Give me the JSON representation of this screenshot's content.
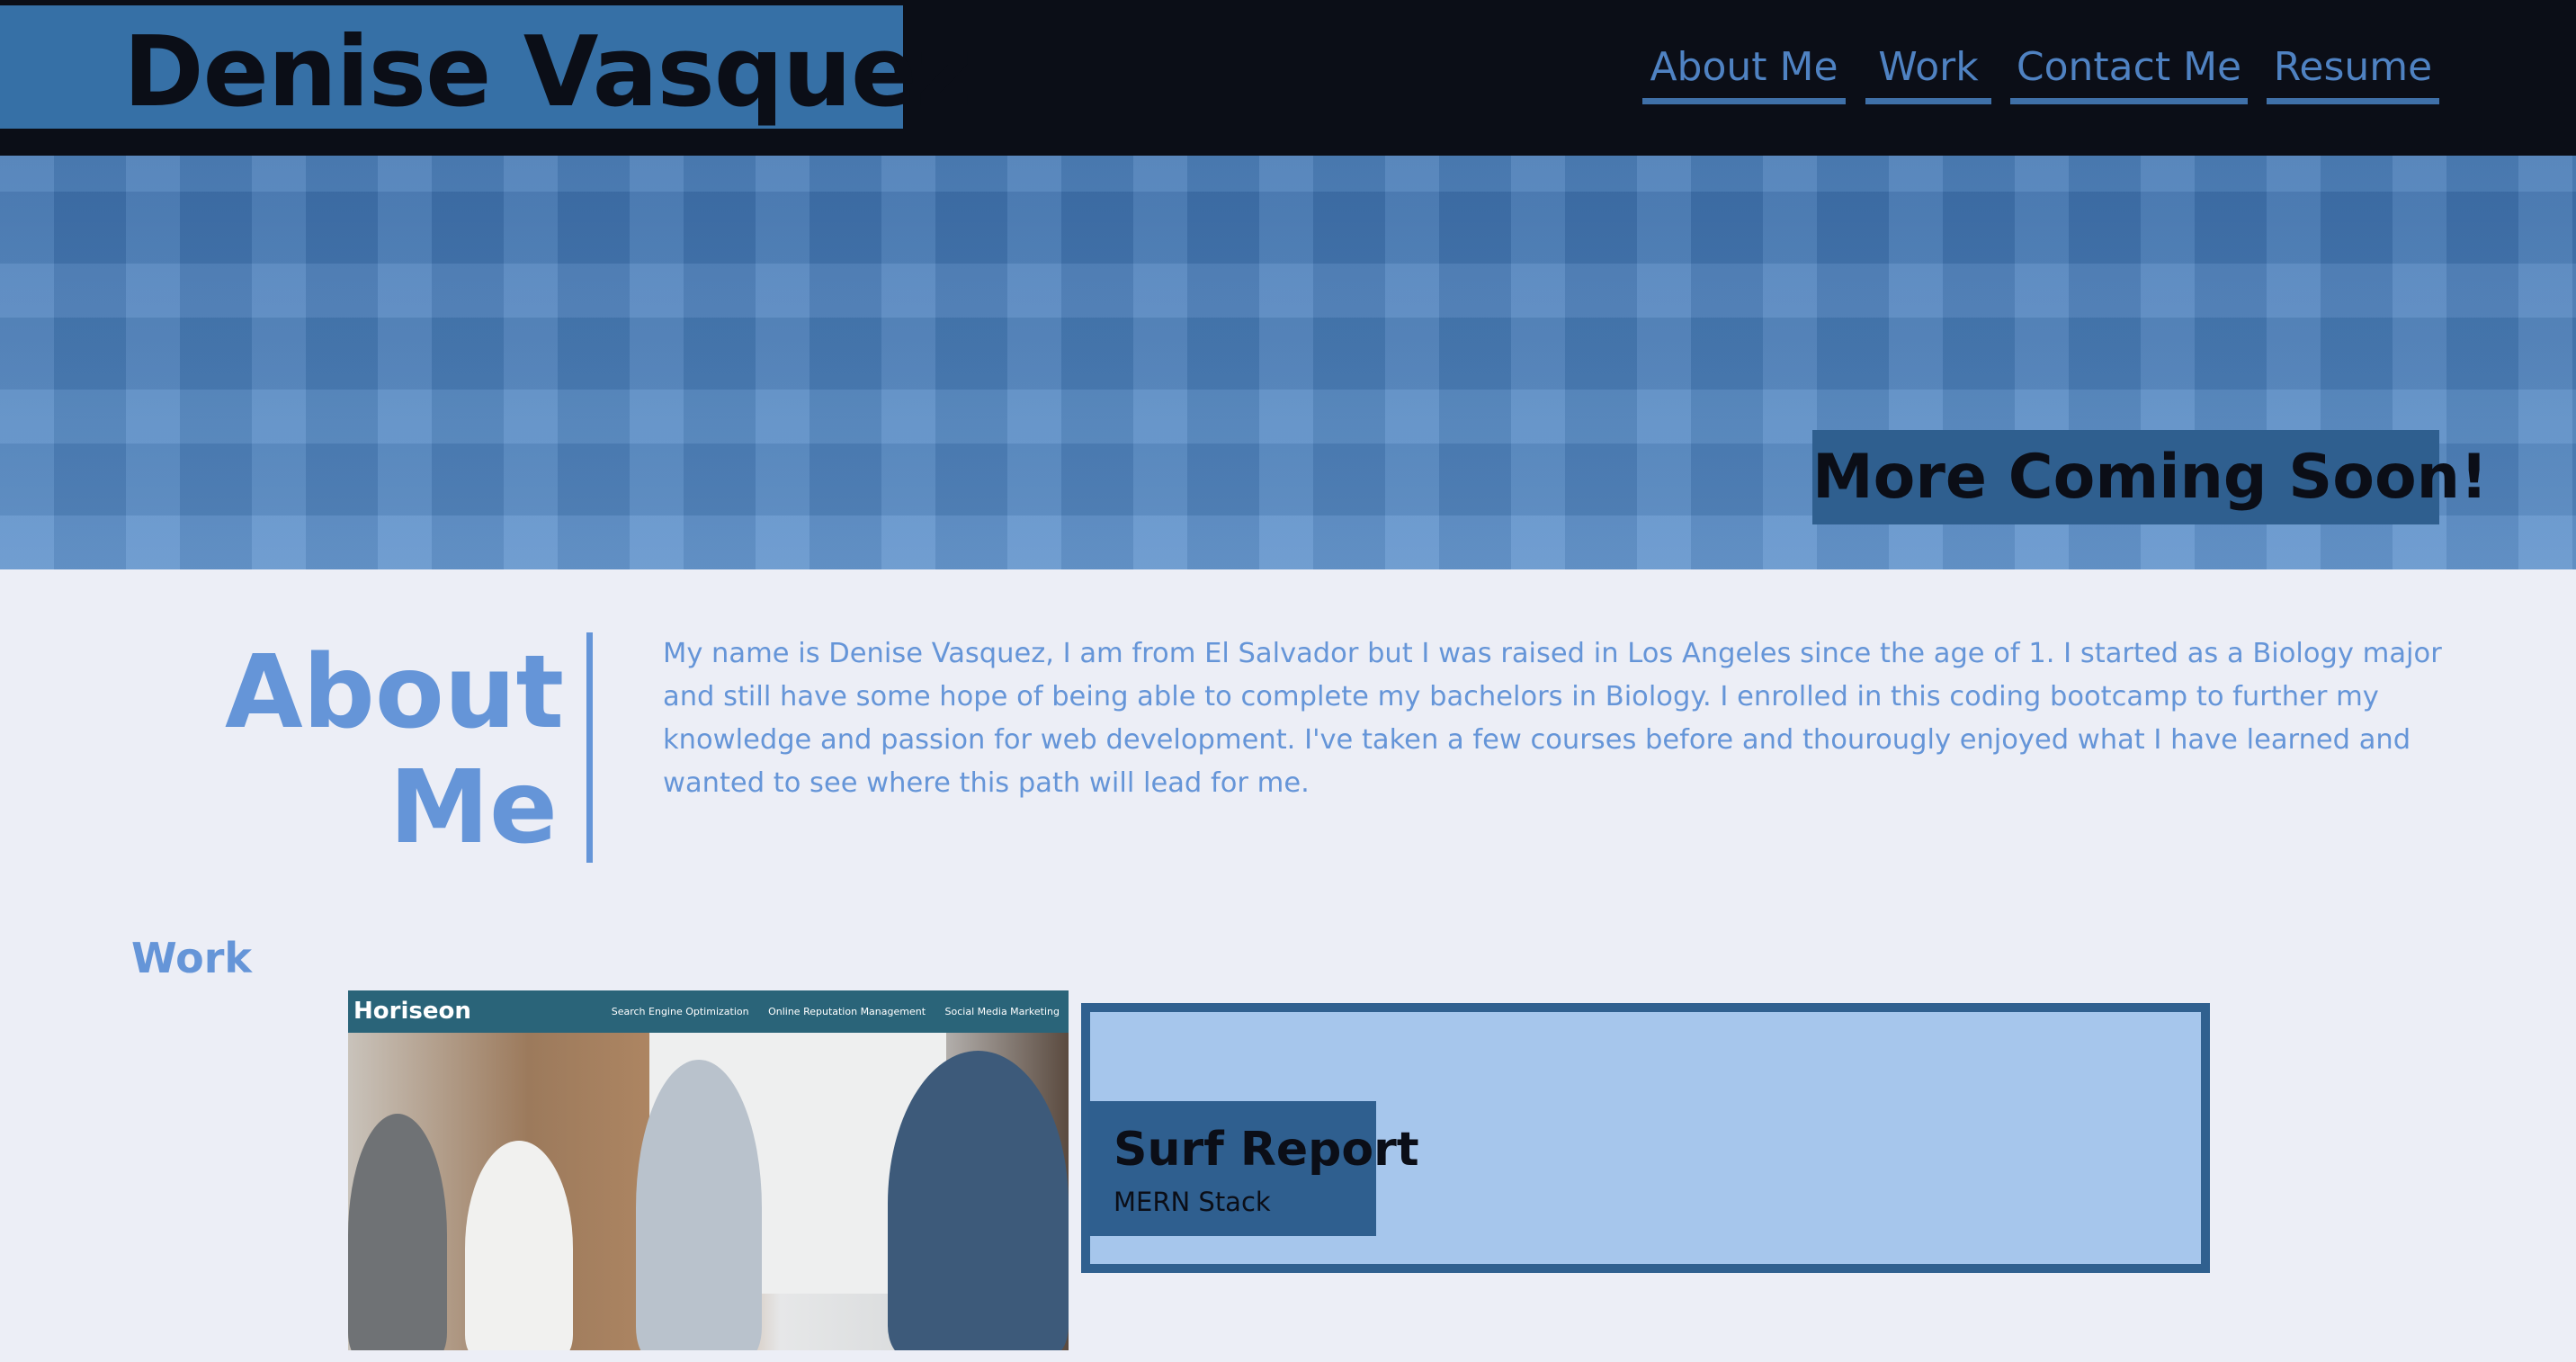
{
  "header": {
    "name": "Denise Vasquez",
    "nav": [
      "About Me",
      "Work",
      "Contact Me",
      "Resume"
    ]
  },
  "hero": {
    "banner": "More Coming Soon!"
  },
  "about": {
    "title": "About Me",
    "body": "My name is Denise Vasquez, I am from El Salvador but I was raised in Los Angeles since the age of 1. I started as a Biology major and still have some hope of being able to complete my bachelors in Biology. I enrolled in this coding bootcamp to further my knowledge and passion for web development. I've taken a few courses before and thourougly enjoyed what I have learned and wanted to see where this path will lead for me."
  },
  "work": {
    "title": "Work",
    "projects": [
      {
        "logo": "Horiseon",
        "links": [
          "Search Engine Optimization",
          "Online Reputation Management",
          "Social Media Marketing"
        ]
      },
      {
        "title": "Surf Report",
        "subtitle": "MERN Stack"
      }
    ]
  },
  "colors": {
    "header_bg": "#0b0e17",
    "accent": "#3670a6",
    "text_blue": "#6595d8",
    "page_bg": "#eceef6",
    "project_card": "#a6c6ec"
  }
}
